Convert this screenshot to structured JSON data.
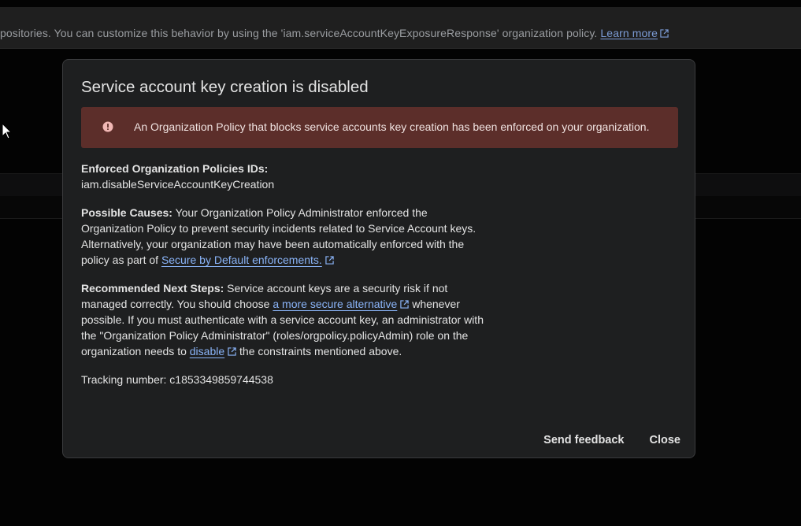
{
  "background": {
    "banner_text": "positories. You can customize this behavior by using the 'iam.serviceAccountKeyExposureResponse' organization policy.",
    "banner_link": "Learn more"
  },
  "dialog": {
    "title": "Service account key creation is disabled",
    "alert": {
      "text": "An Organization Policy that blocks service accounts key creation has been enforced on your organization.",
      "color": "#5c2e2a",
      "icon": "error-icon"
    },
    "enforced": {
      "label": "Enforced Organization Policies IDs:",
      "value": "iam.disableServiceAccountKeyCreation"
    },
    "causes": {
      "label": "Possible Causes:",
      "text": " Your Organization Policy Administrator enforced the Organization Policy to prevent security incidents related to Service Account keys. Alternatively, your organization may have been automatically enforced with the policy as part of ",
      "link": "Secure by Default enforcements."
    },
    "next_steps": {
      "label": "Recommended Next Steps:",
      "text1": " Service account keys are a security risk if not managed correctly. You should choose ",
      "link1": "a more secure alternative",
      "text2": " whenever possible. If you must authenticate with a service account key, an administrator with the \"Organization Policy Administrator\" (roles/orgpolicy.policyAdmin) role on the organization needs to ",
      "link2": "disable",
      "text3": " the constraints mentioned above."
    },
    "tracking": "Tracking number: c1853349859744538",
    "buttons": {
      "feedback": "Send feedback",
      "close": "Close"
    }
  },
  "colors": {
    "link": "#8ab4f8",
    "dialog_bg": "#1e1f20",
    "page_bg": "#030303"
  }
}
